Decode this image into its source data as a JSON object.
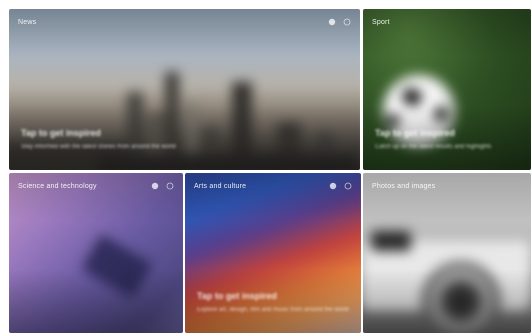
{
  "tiles": {
    "news": {
      "title": "News",
      "cta": "Tap to get inspired",
      "description": "Stay informed with the latest stories from around the world"
    },
    "sport": {
      "title": "Sport",
      "cta": "Tap to get inspired",
      "description": "Catch up on the latest results and highlights"
    },
    "tech": {
      "title": "Science and technology",
      "cta": "",
      "description": ""
    },
    "arts": {
      "title": "Arts and culture",
      "cta": "Tap to get inspired",
      "description": "Explore art, design, film and music from around the world"
    },
    "photo": {
      "title": "Photos and images",
      "cta": "",
      "description": ""
    }
  },
  "icons": {
    "pin": "pin-icon",
    "more": "more-icon"
  },
  "colors": {
    "text": "#ffffff",
    "background": "#ffffff"
  }
}
